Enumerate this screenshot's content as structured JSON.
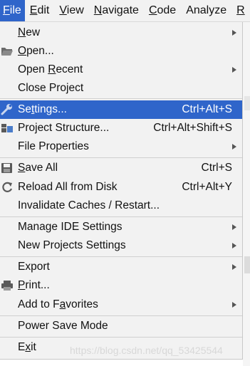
{
  "menubar": {
    "items": [
      {
        "label": "File",
        "mnemonic": "F",
        "rest": "ile"
      },
      {
        "label": "Edit",
        "mnemonic": "E",
        "rest": "dit"
      },
      {
        "label": "View",
        "mnemonic": "V",
        "rest": "iew"
      },
      {
        "label": "Navigate",
        "mnemonic": "N",
        "rest": "avigate"
      },
      {
        "label": "Code",
        "mnemonic": "C",
        "rest": "ode"
      },
      {
        "label": "Analyze",
        "mnemonic": "",
        "rest": "Analyze"
      },
      {
        "label": "R",
        "mnemonic": "R",
        "rest": ""
      }
    ]
  },
  "file_menu": {
    "items": [
      {
        "pre": "",
        "mn": "N",
        "post": "ew",
        "shortcut": "",
        "submenu": true,
        "icon": ""
      },
      {
        "pre": "",
        "mn": "O",
        "post": "pen...",
        "shortcut": "",
        "submenu": false,
        "icon": "folder-icon"
      },
      {
        "pre": "Open ",
        "mn": "R",
        "post": "ecent",
        "shortcut": "",
        "submenu": true,
        "icon": ""
      },
      {
        "pre": "Close Project",
        "mn": "",
        "post": "",
        "shortcut": "",
        "submenu": false,
        "icon": ""
      },
      {
        "pre": "Se",
        "mn": "t",
        "post": "tings...",
        "shortcut": "Ctrl+Alt+S",
        "submenu": false,
        "icon": "wrench-icon",
        "selected": true
      },
      {
        "pre": "Project Structure...",
        "mn": "",
        "post": "",
        "shortcut": "Ctrl+Alt+Shift+S",
        "submenu": false,
        "icon": "project-structure-icon"
      },
      {
        "pre": "File Properties",
        "mn": "",
        "post": "",
        "shortcut": "",
        "submenu": true,
        "icon": ""
      },
      {
        "pre": "",
        "mn": "S",
        "post": "ave All",
        "shortcut": "Ctrl+S",
        "submenu": false,
        "icon": "save-icon"
      },
      {
        "pre": "Reload All from Disk",
        "mn": "",
        "post": "",
        "shortcut": "Ctrl+Alt+Y",
        "submenu": false,
        "icon": "reload-icon"
      },
      {
        "pre": "Invalidate Caches / Restart...",
        "mn": "",
        "post": "",
        "shortcut": "",
        "submenu": false,
        "icon": ""
      },
      {
        "pre": "Manage IDE Settings",
        "mn": "",
        "post": "",
        "shortcut": "",
        "submenu": true,
        "icon": ""
      },
      {
        "pre": "New Projects Settings",
        "mn": "",
        "post": "",
        "shortcut": "",
        "submenu": true,
        "icon": ""
      },
      {
        "pre": "Export",
        "mn": "",
        "post": "",
        "shortcut": "",
        "submenu": true,
        "icon": ""
      },
      {
        "pre": "",
        "mn": "P",
        "post": "rint...",
        "shortcut": "",
        "submenu": false,
        "icon": "print-icon"
      },
      {
        "pre": "Add to F",
        "mn": "a",
        "post": "vorites",
        "shortcut": "",
        "submenu": true,
        "icon": ""
      },
      {
        "pre": "Power Save Mode",
        "mn": "",
        "post": "",
        "shortcut": "",
        "submenu": false,
        "icon": ""
      },
      {
        "pre": "E",
        "mn": "x",
        "post": "it",
        "shortcut": "",
        "submenu": false,
        "icon": ""
      }
    ]
  },
  "watermark": "https://blog.csdn.net/qq_53425544",
  "colors": {
    "selection": "#2f65ca",
    "menu_background": "#f2f2f2",
    "separator": "#d0d0d0"
  }
}
